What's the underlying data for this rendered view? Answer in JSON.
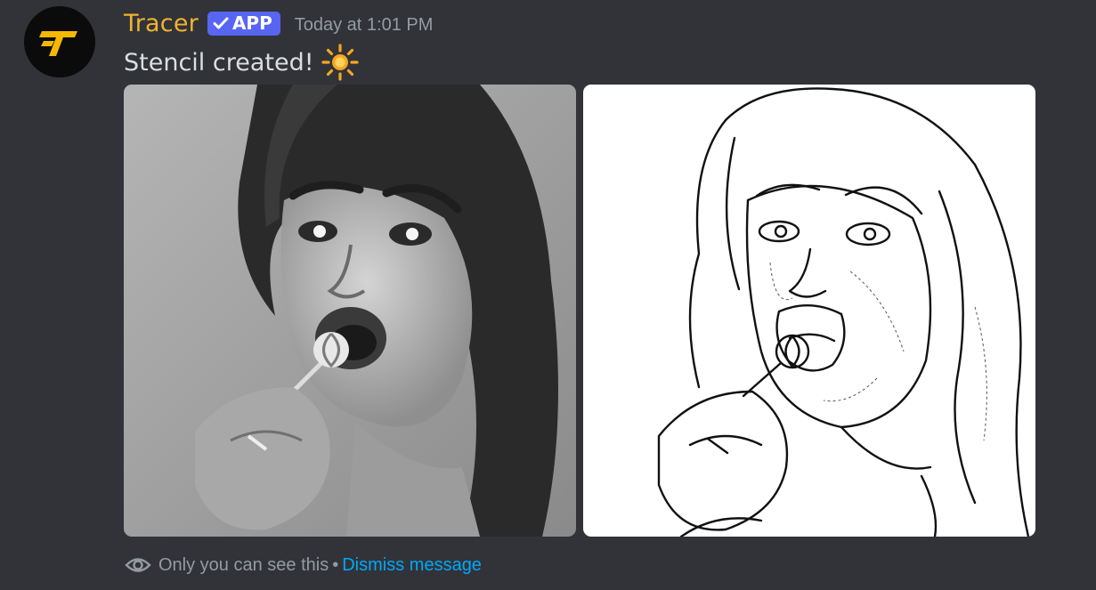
{
  "author": {
    "name": "Tracer",
    "badge": "APP",
    "timestamp": "Today at 1:01 PM",
    "name_color": "#f0b232"
  },
  "message": {
    "text": "Stencil created!",
    "emoji": "sun-icon"
  },
  "attachments": [
    {
      "kind": "grayscale-photo",
      "subject": "portrait"
    },
    {
      "kind": "line-art-stencil",
      "subject": "portrait"
    }
  ],
  "ephemeral": {
    "notice": "Only you can see this",
    "separator": "•",
    "dismiss_label": "Dismiss message",
    "link_color": "#00a8fc"
  },
  "colors": {
    "background": "#313338",
    "badge": "#5865f2",
    "text": "#dbdee1",
    "muted": "#949ba4"
  }
}
